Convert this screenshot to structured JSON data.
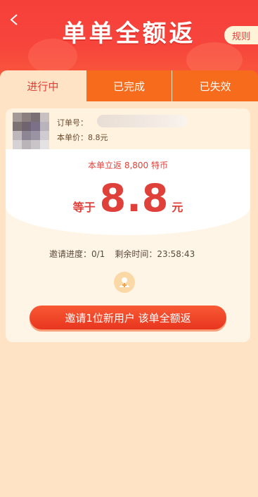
{
  "header": {
    "title": "单单全额返",
    "rules_label": "规则",
    "back_icon": "chevron-left-icon"
  },
  "tabs": [
    {
      "label": "进行中",
      "active": true
    },
    {
      "label": "已完成",
      "active": false
    },
    {
      "label": "已失效",
      "active": false
    }
  ],
  "order": {
    "order_no_label": "订单号：",
    "price_text": "本单价：8.8元"
  },
  "reward": {
    "rebate_text": "本单立返 8,800 特币",
    "equal_label": "等于",
    "amount": "8.8",
    "unit": "元"
  },
  "progress": {
    "invite_text": "邀请进度：0/1",
    "time_text": "剩余时间：23:58:43"
  },
  "cta_label": "邀请1位新用户 该单全额返",
  "colors": {
    "header_red": "#f5403a",
    "tab_orange": "#f76b1c",
    "accent_red": "#e0403a",
    "page_bg": "#ffe3c4"
  }
}
